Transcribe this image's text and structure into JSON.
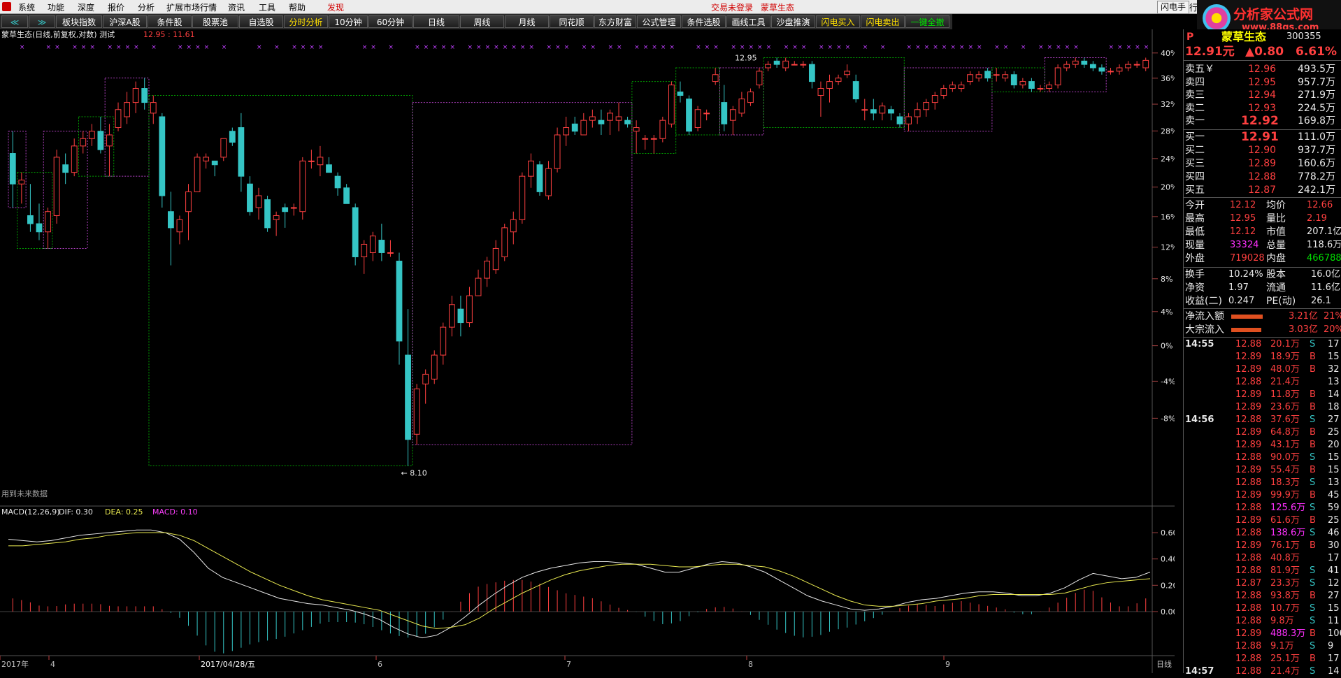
{
  "menu": {
    "items": [
      "系统",
      "功能",
      "深度",
      "报价",
      "分析",
      "扩展市场行情",
      "资讯",
      "工具",
      "帮助"
    ],
    "discover": "发现",
    "status_login": "交易未登录",
    "status_stock": "蒙草生态",
    "fast_hand": "闪电手",
    "fast_hand_extra": "行"
  },
  "toolbar": {
    "back": "≪",
    "forward": "≫",
    "buttons": [
      "板块指数",
      "沪深A股",
      "条件股",
      "股票池",
      "自选股",
      "分时分析",
      "10分钟",
      "60分钟",
      "日线",
      "周线",
      "月线",
      "同花顺",
      "东方财富",
      "公式管理",
      "条件选股",
      "画线工具",
      "沙盘推演",
      "闪电买入",
      "闪电卖出",
      "一键全撤"
    ]
  },
  "logo": {
    "name": "分析家公式网",
    "url": "www.88gs.com"
  },
  "chart_data": {
    "type": "candlestick",
    "title": "蒙草生态(日线,前复权,对数) 测试",
    "title_values": "12.95 : 11.61",
    "y_ticks": [
      "40%",
      "36%",
      "32%",
      "28%",
      "24%",
      "20%",
      "16%",
      "12%",
      "8%",
      "4%",
      "0%",
      "-4%",
      "-8%"
    ],
    "annot_high": "12.95",
    "annot_low": "8.10",
    "future_note": "用到未来数据",
    "candles_ohlc": [
      [
        11.6,
        11.9,
        10.9,
        11.2
      ],
      [
        11.2,
        11.35,
        10.95,
        11.25
      ],
      [
        10.8,
        11.2,
        10.6,
        10.7
      ],
      [
        10.7,
        10.95,
        10.5,
        10.6
      ],
      [
        10.6,
        10.9,
        10.4,
        10.85
      ],
      [
        10.8,
        11.65,
        10.7,
        11.55
      ],
      [
        11.45,
        11.6,
        11.2,
        11.35
      ],
      [
        11.35,
        11.8,
        11.3,
        11.7
      ],
      [
        11.7,
        11.9,
        11.6,
        11.8
      ],
      [
        11.8,
        12.0,
        11.7,
        11.9
      ],
      [
        11.9,
        12.1,
        11.6,
        11.65
      ],
      [
        11.7,
        12.0,
        11.3,
        11.85
      ],
      [
        11.95,
        12.3,
        11.9,
        12.2
      ],
      [
        12.1,
        12.45,
        12.0,
        12.3
      ],
      [
        12.3,
        12.6,
        12.15,
        12.5
      ],
      [
        12.5,
        12.65,
        12.2,
        12.3
      ],
      [
        12.15,
        12.4,
        12.0,
        12.3
      ],
      [
        12.1,
        12.15,
        10.9,
        11.05
      ],
      [
        10.85,
        11.1,
        10.2,
        10.65
      ],
      [
        10.6,
        10.8,
        10.45,
        10.75
      ],
      [
        10.85,
        11.2,
        10.5,
        11.1
      ],
      [
        11.1,
        11.6,
        11.1,
        11.55
      ],
      [
        11.5,
        11.6,
        11.4,
        11.55
      ],
      [
        11.5,
        11.5,
        11.3,
        11.45
      ],
      [
        11.55,
        11.8,
        11.5,
        11.8
      ],
      [
        11.9,
        11.95,
        11.7,
        11.75
      ],
      [
        11.95,
        12.15,
        11.1,
        11.3
      ],
      [
        11.2,
        11.3,
        10.8,
        10.85
      ],
      [
        10.9,
        11.15,
        10.75,
        11.05
      ],
      [
        11.0,
        11.05,
        10.6,
        10.65
      ],
      [
        10.75,
        10.85,
        10.55,
        10.8
      ],
      [
        10.9,
        10.95,
        10.65,
        10.85
      ],
      [
        10.9,
        10.95,
        10.8,
        10.9
      ],
      [
        10.85,
        11.55,
        10.75,
        11.5
      ],
      [
        11.5,
        11.65,
        11.4,
        11.5
      ],
      [
        11.45,
        11.7,
        11.3,
        11.55
      ],
      [
        11.45,
        11.55,
        11.35,
        11.35
      ],
      [
        11.3,
        11.35,
        11.05,
        11.15
      ],
      [
        11.15,
        11.2,
        10.95,
        10.95
      ],
      [
        10.9,
        10.95,
        10.2,
        10.3
      ],
      [
        10.3,
        10.5,
        10.1,
        10.45
      ],
      [
        10.35,
        10.6,
        10.25,
        10.55
      ],
      [
        10.5,
        10.7,
        10.25,
        10.35
      ],
      [
        10.35,
        10.5,
        10.3,
        10.35
      ],
      [
        10.25,
        10.35,
        9.1,
        9.35
      ],
      [
        9.2,
        9.7,
        8.1,
        8.35
      ],
      [
        8.4,
        8.9,
        8.3,
        8.85
      ],
      [
        8.9,
        9.05,
        8.7,
        9.0
      ],
      [
        8.95,
        9.25,
        8.9,
        9.2
      ],
      [
        9.2,
        9.55,
        9.1,
        9.5
      ],
      [
        9.5,
        9.85,
        9.4,
        9.75
      ],
      [
        9.7,
        9.85,
        9.4,
        9.55
      ],
      [
        9.55,
        9.95,
        9.5,
        9.85
      ],
      [
        9.85,
        10.15,
        9.85,
        10.05
      ],
      [
        10.05,
        10.3,
        9.95,
        10.25
      ],
      [
        10.15,
        10.5,
        10.1,
        10.4
      ],
      [
        10.3,
        10.7,
        10.25,
        10.65
      ],
      [
        10.6,
        10.85,
        10.45,
        10.75
      ],
      [
        10.75,
        11.35,
        10.7,
        11.3
      ],
      [
        11.3,
        11.6,
        11.15,
        11.5
      ],
      [
        11.45,
        11.5,
        11.05,
        11.1
      ],
      [
        11.05,
        11.5,
        11.0,
        11.4
      ],
      [
        11.4,
        11.95,
        11.35,
        11.85
      ],
      [
        11.85,
        12.1,
        11.7,
        11.95
      ],
      [
        12.0,
        12.1,
        11.85,
        11.9
      ],
      [
        11.85,
        12.15,
        11.85,
        12.05
      ],
      [
        12.05,
        12.2,
        11.95,
        12.1
      ],
      [
        12.05,
        12.2,
        11.85,
        12.0
      ],
      [
        12.05,
        12.2,
        11.85,
        12.15
      ],
      [
        12.05,
        12.3,
        11.9,
        12.1
      ],
      [
        12.05,
        12.1,
        11.95,
        12.0
      ],
      [
        11.9,
        12.05,
        11.6,
        11.95
      ],
      [
        11.8,
        11.85,
        11.65,
        11.8
      ],
      [
        11.8,
        11.85,
        11.6,
        11.8
      ],
      [
        11.8,
        12.1,
        11.75,
        12.05
      ],
      [
        12.0,
        12.6,
        11.95,
        12.55
      ],
      [
        12.45,
        12.6,
        12.3,
        12.4
      ],
      [
        12.35,
        12.4,
        11.85,
        11.9
      ],
      [
        11.95,
        12.25,
        11.9,
        12.2
      ],
      [
        12.15,
        12.2,
        12.05,
        12.15
      ],
      [
        12.6,
        12.8,
        12.55,
        12.7
      ],
      [
        12.3,
        12.55,
        11.9,
        12.0
      ],
      [
        12.05,
        12.25,
        11.85,
        12.2
      ],
      [
        12.15,
        12.45,
        12.1,
        12.35
      ],
      [
        12.3,
        12.5,
        12.25,
        12.45
      ],
      [
        12.55,
        12.8,
        12.5,
        12.75
      ],
      [
        12.8,
        12.9,
        12.75,
        12.85
      ],
      [
        12.9,
        12.95,
        12.8,
        12.85
      ],
      [
        12.8,
        12.95,
        12.75,
        12.9
      ],
      [
        12.85,
        12.9,
        12.85,
        12.85
      ],
      [
        12.85,
        12.9,
        12.8,
        12.85
      ],
      [
        12.85,
        12.9,
        12.5,
        12.6
      ],
      [
        12.4,
        12.6,
        12.1,
        12.5
      ],
      [
        12.5,
        12.7,
        12.3,
        12.6
      ],
      [
        12.6,
        12.7,
        12.55,
        12.65
      ],
      [
        12.7,
        12.85,
        12.65,
        12.75
      ],
      [
        12.6,
        12.7,
        12.3,
        12.35
      ],
      [
        12.2,
        12.35,
        12.05,
        12.2
      ],
      [
        12.2,
        12.35,
        12.05,
        12.15
      ],
      [
        12.15,
        12.3,
        12.05,
        12.25
      ],
      [
        12.2,
        12.25,
        12.05,
        12.15
      ],
      [
        12.1,
        12.15,
        11.95,
        12.0
      ],
      [
        12.0,
        12.15,
        11.9,
        12.1
      ],
      [
        12.1,
        12.3,
        12.0,
        12.2
      ],
      [
        12.2,
        12.35,
        12.1,
        12.3
      ],
      [
        12.3,
        12.45,
        12.2,
        12.4
      ],
      [
        12.4,
        12.55,
        12.35,
        12.5
      ],
      [
        12.5,
        12.6,
        12.45,
        12.55
      ],
      [
        12.5,
        12.6,
        12.45,
        12.55
      ],
      [
        12.6,
        12.75,
        12.55,
        12.7
      ],
      [
        12.65,
        12.75,
        12.6,
        12.7
      ],
      [
        12.75,
        12.8,
        12.6,
        12.65
      ],
      [
        12.7,
        12.8,
        12.6,
        12.7
      ],
      [
        12.65,
        12.75,
        12.6,
        12.7
      ],
      [
        12.7,
        12.75,
        12.5,
        12.55
      ],
      [
        12.55,
        12.65,
        12.5,
        12.6
      ],
      [
        12.6,
        12.65,
        12.45,
        12.5
      ],
      [
        12.5,
        12.55,
        12.45,
        12.5
      ],
      [
        12.5,
        12.6,
        12.45,
        12.55
      ],
      [
        12.55,
        12.85,
        12.5,
        12.8
      ],
      [
        12.8,
        12.9,
        12.75,
        12.85
      ],
      [
        12.85,
        12.95,
        12.8,
        12.9
      ],
      [
        12.9,
        12.95,
        12.8,
        12.85
      ],
      [
        12.85,
        12.9,
        12.75,
        12.8
      ],
      [
        12.8,
        12.85,
        12.7,
        12.75
      ],
      [
        12.75,
        12.8,
        12.7,
        12.75
      ],
      [
        12.75,
        12.85,
        12.7,
        12.8
      ],
      [
        12.8,
        12.9,
        12.75,
        12.85
      ],
      [
        12.85,
        12.9,
        12.8,
        12.85
      ],
      [
        12.8,
        12.95,
        12.75,
        12.91
      ]
    ],
    "macd": {
      "label": "MACD(12,26,9)",
      "dif_label": "DIF: 0.30",
      "dea_label": "DEA: 0.25",
      "macd_label": "MACD: 0.10",
      "y_ticks": [
        "0.60",
        "0.40",
        "0.20",
        "0.00"
      ],
      "dif": [
        0.55,
        0.54,
        0.53,
        0.54,
        0.56,
        0.58,
        0.59,
        0.6,
        0.61,
        0.62,
        0.62,
        0.6,
        0.55,
        0.45,
        0.33,
        0.26,
        0.22,
        0.18,
        0.14,
        0.1,
        0.08,
        0.06,
        0.05,
        0.03,
        0.01,
        -0.02,
        -0.06,
        -0.12,
        -0.17,
        -0.2,
        -0.18,
        -0.12,
        -0.04,
        0.05,
        0.13,
        0.2,
        0.26,
        0.3,
        0.33,
        0.35,
        0.37,
        0.38,
        0.38,
        0.37,
        0.36,
        0.33,
        0.3,
        0.3,
        0.33,
        0.36,
        0.38,
        0.37,
        0.34,
        0.3,
        0.24,
        0.18,
        0.12,
        0.08,
        0.05,
        0.02,
        0.01,
        0.02,
        0.04,
        0.07,
        0.09,
        0.1,
        0.12,
        0.14,
        0.15,
        0.15,
        0.14,
        0.12,
        0.12,
        0.14,
        0.18,
        0.24,
        0.29,
        0.27,
        0.25,
        0.26,
        0.3
      ],
      "dea": [
        0.5,
        0.5,
        0.51,
        0.52,
        0.53,
        0.55,
        0.56,
        0.58,
        0.59,
        0.6,
        0.6,
        0.6,
        0.58,
        0.54,
        0.48,
        0.42,
        0.36,
        0.3,
        0.25,
        0.2,
        0.16,
        0.12,
        0.09,
        0.07,
        0.05,
        0.03,
        0.01,
        -0.03,
        -0.07,
        -0.11,
        -0.13,
        -0.12,
        -0.1,
        -0.05,
        0.02,
        0.08,
        0.14,
        0.19,
        0.24,
        0.28,
        0.31,
        0.33,
        0.35,
        0.36,
        0.36,
        0.36,
        0.35,
        0.34,
        0.34,
        0.35,
        0.36,
        0.36,
        0.35,
        0.34,
        0.31,
        0.27,
        0.22,
        0.17,
        0.12,
        0.08,
        0.05,
        0.04,
        0.04,
        0.05,
        0.06,
        0.08,
        0.09,
        0.1,
        0.12,
        0.13,
        0.13,
        0.13,
        0.13,
        0.13,
        0.14,
        0.17,
        0.2,
        0.22,
        0.23,
        0.24,
        0.25
      ]
    },
    "x_labels": [
      "2017年",
      "4",
      "2017/04/28/五",
      "6",
      "7",
      "8",
      "9"
    ],
    "x_label_right": "日线"
  },
  "panel": {
    "indicator": "P",
    "stock_name": "蒙草生态",
    "stock_code": "300355",
    "price": "12.91元",
    "change": "▲0.80",
    "change_pct": "6.61%",
    "asks": [
      {
        "label": "卖五￥",
        "price": "12.96",
        "vol": "493.5万"
      },
      {
        "label": "卖四",
        "price": "12.95",
        "vol": "957.7万"
      },
      {
        "label": "卖三",
        "price": "12.94",
        "vol": "271.9万"
      },
      {
        "label": "卖二",
        "price": "12.93",
        "vol": "224.5万"
      },
      {
        "label": "卖一",
        "price": "12.92",
        "vol": "169.8万"
      }
    ],
    "bids": [
      {
        "label": "买一",
        "price": "12.91",
        "vol": "111.0万"
      },
      {
        "label": "买二",
        "price": "12.90",
        "vol": "937.7万"
      },
      {
        "label": "买三",
        "price": "12.89",
        "vol": "160.6万"
      },
      {
        "label": "买四",
        "price": "12.88",
        "vol": "778.2万"
      },
      {
        "label": "买五",
        "price": "12.87",
        "vol": "242.1万"
      }
    ],
    "stats": [
      {
        "l1": "今开",
        "v1": "12.12",
        "l2": "均价",
        "v2": "12.66"
      },
      {
        "l1": "最高",
        "v1": "12.95",
        "l2": "量比",
        "v2": "2.19"
      },
      {
        "l1": "最低",
        "v1": "12.12",
        "l2": "市值",
        "v2": "207.1亿"
      },
      {
        "l1": "现量",
        "v1": "33324",
        "l2": "总量",
        "v2": "118.6万"
      },
      {
        "l1": "外盘",
        "v1": "719028",
        "l2": "内盘",
        "v2": "466788"
      }
    ],
    "fund": [
      {
        "l1": "换手",
        "v1": "10.24%",
        "l2": "股本",
        "v2": "16.0亿"
      },
      {
        "l1": "净资",
        "v1": "1.97",
        "l2": "流通",
        "v2": "11.6亿"
      },
      {
        "l1": "收益(二)",
        "v1": "0.247",
        "l2": "PE(动)",
        "v2": "26.1"
      }
    ],
    "flows": [
      {
        "label": "净流入额",
        "val": "3.21亿",
        "pct": "21%",
        "fill": 0.9
      },
      {
        "label": "大宗流入",
        "val": "3.03亿",
        "pct": "20%",
        "fill": 0.85
      }
    ],
    "ticks": [
      {
        "t": "14:55",
        "p": "12.88",
        "v": "20.1万",
        "s": "S",
        "n": "17"
      },
      {
        "t": "",
        "p": "12.89",
        "v": "18.9万",
        "s": "B",
        "n": "15"
      },
      {
        "t": "",
        "p": "12.89",
        "v": "48.0万",
        "s": "B",
        "n": "32"
      },
      {
        "t": "",
        "p": "12.88",
        "v": "21.4万",
        "s": "",
        "n": "13"
      },
      {
        "t": "",
        "p": "12.89",
        "v": "11.8万",
        "s": "B",
        "n": "14"
      },
      {
        "t": "",
        "p": "12.89",
        "v": "23.6万",
        "s": "B",
        "n": "18"
      },
      {
        "t": "14:56",
        "p": "12.88",
        "v": "37.6万",
        "s": "S",
        "n": "27"
      },
      {
        "t": "",
        "p": "12.89",
        "v": "64.8万",
        "s": "B",
        "n": "25"
      },
      {
        "t": "",
        "p": "12.89",
        "v": "43.1万",
        "s": "B",
        "n": "20"
      },
      {
        "t": "",
        "p": "12.88",
        "v": "90.0万",
        "s": "S",
        "n": "15"
      },
      {
        "t": "",
        "p": "12.89",
        "v": "55.4万",
        "s": "B",
        "n": "15"
      },
      {
        "t": "",
        "p": "12.88",
        "v": "18.3万",
        "s": "S",
        "n": "13"
      },
      {
        "t": "",
        "p": "12.89",
        "v": "99.9万",
        "s": "B",
        "n": "45"
      },
      {
        "t": "",
        "p": "12.88",
        "v": "125.6万",
        "s": "S",
        "n": "59"
      },
      {
        "t": "",
        "p": "12.89",
        "v": "61.6万",
        "s": "B",
        "n": "25"
      },
      {
        "t": "",
        "p": "12.88",
        "v": "138.6万",
        "s": "S",
        "n": "46"
      },
      {
        "t": "",
        "p": "12.89",
        "v": "76.1万",
        "s": "B",
        "n": "30"
      },
      {
        "t": "",
        "p": "12.88",
        "v": "40.8万",
        "s": "",
        "n": "17"
      },
      {
        "t": "",
        "p": "12.88",
        "v": "81.9万",
        "s": "S",
        "n": "41"
      },
      {
        "t": "",
        "p": "12.87",
        "v": "23.3万",
        "s": "S",
        "n": "12"
      },
      {
        "t": "",
        "p": "12.88",
        "v": "93.8万",
        "s": "B",
        "n": "27"
      },
      {
        "t": "",
        "p": "12.88",
        "v": "10.7万",
        "s": "S",
        "n": "15"
      },
      {
        "t": "",
        "p": "12.88",
        "v": "9.8万",
        "s": "S",
        "n": "11"
      },
      {
        "t": "",
        "p": "12.89",
        "v": "488.3万",
        "s": "B",
        "n": "106"
      },
      {
        "t": "",
        "p": "12.88",
        "v": "9.1万",
        "s": "S",
        "n": "9"
      },
      {
        "t": "",
        "p": "12.88",
        "v": "25.1万",
        "s": "B",
        "n": "17"
      },
      {
        "t": "14:57",
        "p": "12.88",
        "v": "21.4万",
        "s": "S",
        "n": "14"
      }
    ]
  },
  "colors": {
    "up": "#ff4040",
    "down": "#35c5c5",
    "green_box": "#00a000",
    "purple_box": "#b040c0",
    "dif": "#e8e8e8",
    "dea": "#e8e850"
  }
}
